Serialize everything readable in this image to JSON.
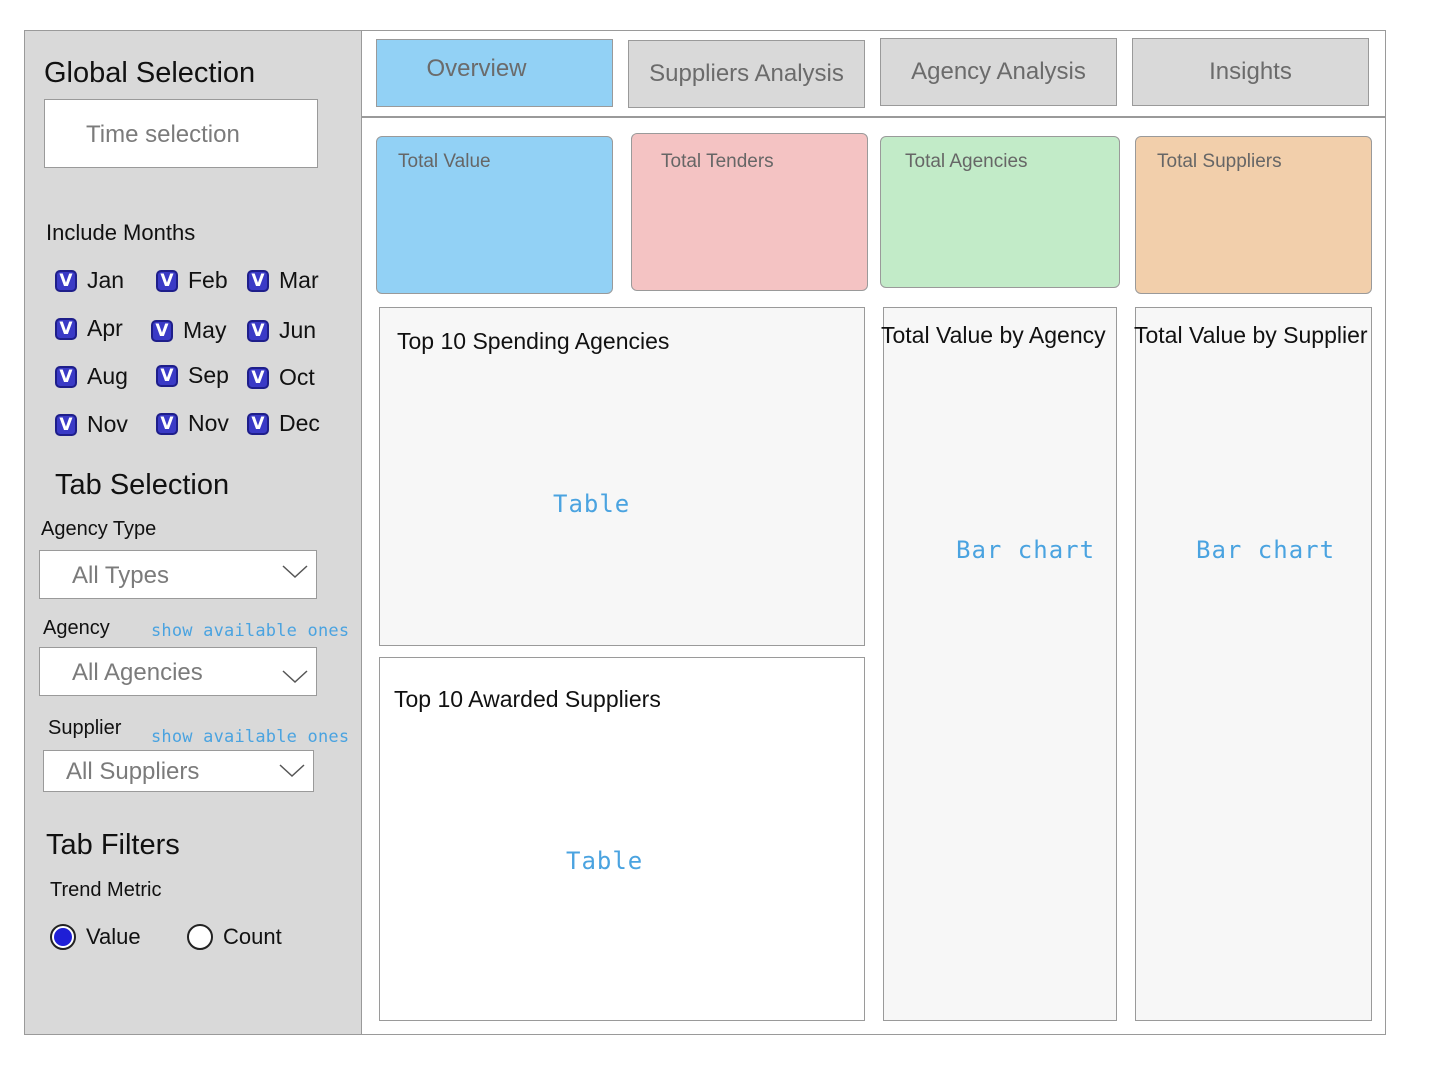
{
  "sidebar": {
    "global_title": "Global Selection",
    "time_placeholder": "Time selection",
    "months_title": "Include Months",
    "months": [
      "Jan",
      "Feb",
      "Mar",
      "Apr",
      "May",
      "Jun",
      "Aug",
      "Sep",
      "Oct",
      "Nov",
      "Nov",
      "Dec"
    ],
    "checkbox_mark": "V",
    "tab_selection_title": "Tab Selection",
    "agency_type_label": "Agency Type",
    "agency_type_value": "All Types",
    "agency_label": "Agency",
    "agency_hint": "show available ones",
    "agency_value": "All Agencies",
    "supplier_label": "Supplier",
    "supplier_hint": "show available ones",
    "supplier_value": "All Suppliers",
    "tab_filters_title": "Tab Filters",
    "trend_metric_label": "Trend Metric",
    "radio_value": "Value",
    "radio_count": "Count",
    "selected_metric": "Value"
  },
  "tabs": [
    {
      "label": "Overview",
      "active": true
    },
    {
      "label": "Suppliers Analysis",
      "active": false
    },
    {
      "label": "Agency Analysis",
      "active": false
    },
    {
      "label": "Insights",
      "active": false
    }
  ],
  "kpis": [
    {
      "label": "Total Value",
      "color": "#92d1f5"
    },
    {
      "label": "Total Tenders",
      "color": "#f4c3c3"
    },
    {
      "label": "Total Agencies",
      "color": "#c2ebc8"
    },
    {
      "label": "Total Suppliers",
      "color": "#f2cfab"
    }
  ],
  "panels": {
    "spending_title": "Top 10 Spending Agencies",
    "spending_placeholder": "Table",
    "awarded_title": "Top 10 Awarded Suppliers",
    "awarded_placeholder": "Table",
    "by_agency_title": "Total Value by Agency",
    "by_agency_placeholder": "Bar chart",
    "by_supplier_title": "Total Value by Supplier",
    "by_supplier_placeholder": "Bar chart"
  },
  "colors": {
    "sidebar_bg": "#d9d9d9",
    "active_tab": "#92d1f5",
    "checkbox": "#3a3ac6",
    "radio_selected": "#1f1fd6",
    "sketch_text": "#4aa3e0"
  }
}
